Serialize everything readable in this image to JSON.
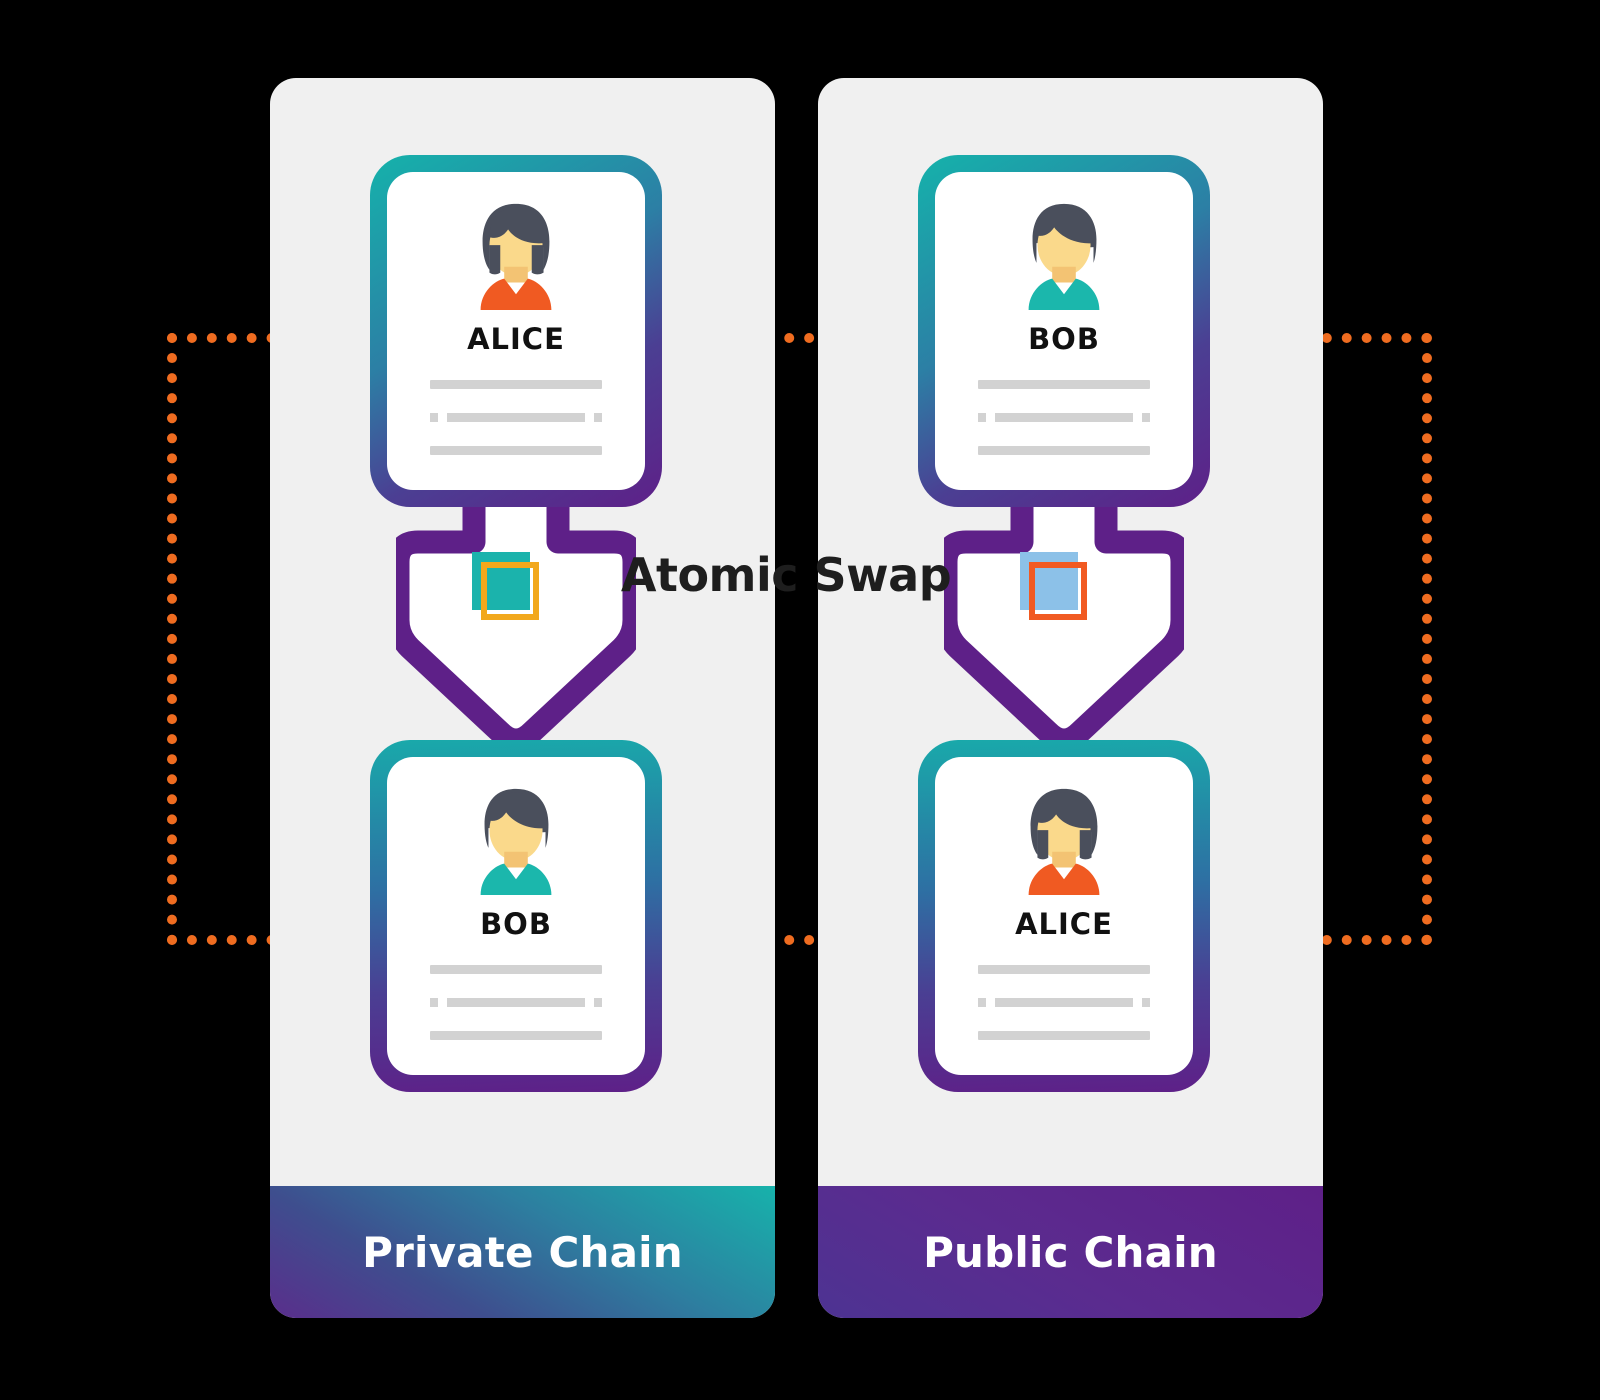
{
  "diagram": {
    "title": "Atomic Swap",
    "background_color": "#000000",
    "accent_dotted_color": "#EF6C20"
  },
  "swap_label": "Atomic Swap",
  "panels": [
    {
      "id": "private-chain",
      "footer_label": "Private Chain",
      "footer_gradient": "#5A2E8C -> #17B2AB",
      "cards": [
        {
          "name": "ALICE",
          "avatar": "female-avatar-icon",
          "shirt_color": "#F05A22",
          "hair_color": "#4A4F5C",
          "skin_color": "#FAD98B",
          "position": "top"
        },
        {
          "name": "BOB",
          "avatar": "male-avatar-icon",
          "shirt_color": "#1BB7AC",
          "hair_color": "#4A4F5C",
          "skin_color": "#FAD98B",
          "position": "bottom"
        }
      ],
      "token": {
        "back_color": "#1BB3AC",
        "front_border_color": "#F2A81D",
        "name": "private-chain-token"
      },
      "arrow_color": "#5E2088"
    },
    {
      "id": "public-chain",
      "footer_label": "Public Chain",
      "footer_gradient": "#4D3392 -> #5E2088",
      "cards": [
        {
          "name": "BOB",
          "avatar": "male-avatar-icon",
          "shirt_color": "#1BB7AC",
          "hair_color": "#4A4F5C",
          "skin_color": "#FAD98B",
          "position": "top"
        },
        {
          "name": "ALICE",
          "avatar": "female-avatar-icon",
          "shirt_color": "#F05A22",
          "hair_color": "#4A4F5C",
          "skin_color": "#FAD98B",
          "position": "bottom"
        }
      ],
      "token": {
        "back_color": "#8CC1E8",
        "front_border_color": "#F15A22",
        "name": "public-chain-token"
      },
      "arrow_color": "#5E2088"
    }
  ],
  "placeholder_lines": {
    "line_color": "#D2D2D2",
    "count": 3
  }
}
